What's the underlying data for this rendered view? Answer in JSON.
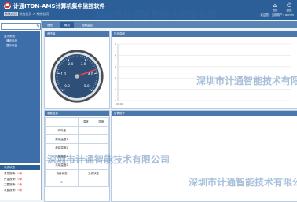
{
  "header": {
    "title": "计通ITON-AMS计算机集中监控软件",
    "breadcrumb_current": "系统首页",
    "breadcrumb_rest": "  系统首页 > 系统首页",
    "buttons": [
      {
        "icon": "home-icon",
        "label": "首页"
      },
      {
        "icon": "exit-icon",
        "label": "退出"
      }
    ],
    "user_info": "欢迎您：当前用户：admin"
  },
  "sidebar": {
    "search_placeholder": "",
    "tree": [
      "显示系统",
      "通讯系统",
      "显示系统"
    ],
    "status_title": "系统状态",
    "status_rows": [
      {
        "label": "紧急报警：",
        "value": "0条"
      },
      {
        "label": "严重报警：",
        "value": "0条"
      },
      {
        "label": "主要报警：",
        "value": "0条"
      },
      {
        "label": "次要报警：",
        "value": "0条"
      }
    ]
  },
  "tabs": [
    "首页",
    "概况",
    "视频监控"
  ],
  "panels": {
    "gauge_title": "声压级",
    "gauge_ticks": [
      "0.0",
      "1.0",
      "2.0",
      "3.0",
      "4.0",
      "5.0"
    ],
    "gauge_value": 3.8,
    "chart_title": "历史曲线",
    "chart_ylabels": [
      "5",
      "4",
      "3",
      "2",
      "1",
      "0"
    ],
    "chart_xlabel": "00:00",
    "params_title": "参数信息",
    "params_header": [
      "温度",
      "湿度"
    ],
    "params_rows": [
      "平均温",
      "前端温度1",
      "前端温度2",
      "末端温度1",
      "末端温度2"
    ],
    "params_footer": [
      "设备状态",
      "工作状态"
    ],
    "params_footer_value": "0",
    "alarm_title": "告警统计"
  },
  "watermark": "深圳市计通智能技术有限公司"
}
